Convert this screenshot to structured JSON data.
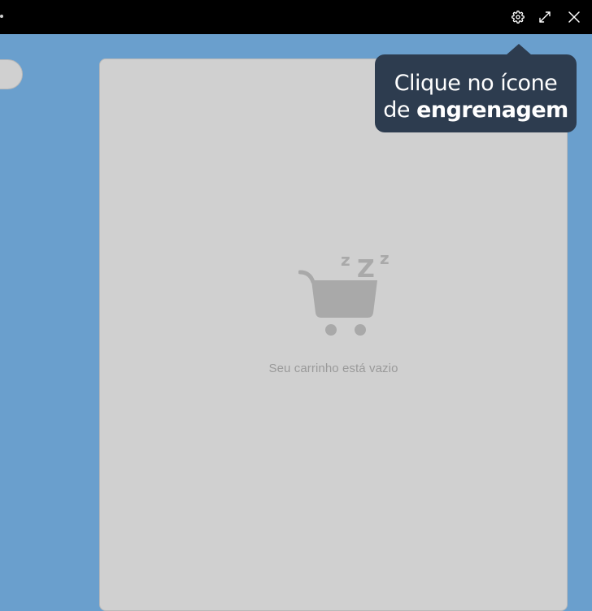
{
  "titlebar": {
    "icons": {
      "settings": "gear-icon",
      "expand": "expand-icon",
      "close": "close-icon"
    }
  },
  "cart": {
    "empty_message": "Seu carrinho está vazio",
    "empty_icon": "sleeping-cart-icon",
    "sleep_letters": [
      "z",
      "Z",
      "z"
    ]
  },
  "tooltip": {
    "line1": "Clique no ícone",
    "line2_prefix": "de ",
    "line2_emphasis": "engrenagem"
  },
  "colors": {
    "background": "#6a9fcd",
    "titlebar": "#000000",
    "panel": "#d0d0d0",
    "tooltip": "#2d3c4f",
    "muted_text": "#9a9a9a"
  }
}
